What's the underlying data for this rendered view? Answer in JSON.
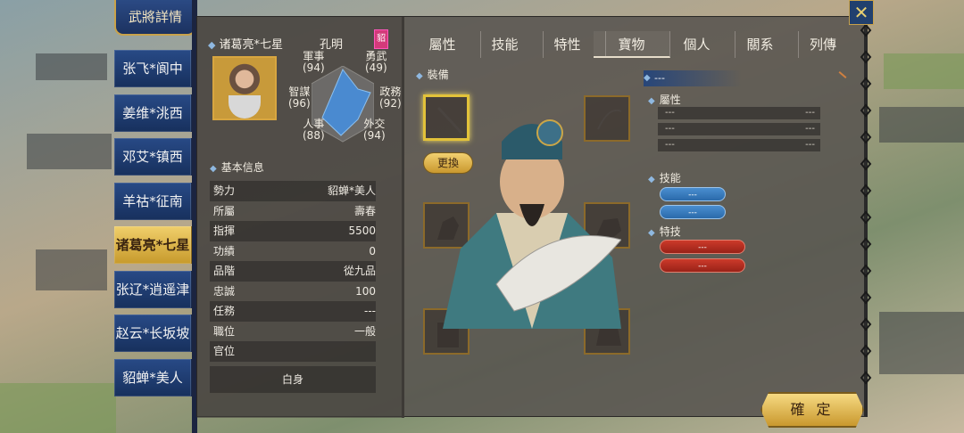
{
  "general_list": {
    "title": "武將詳情",
    "items": [
      {
        "label": "张飞*阆中"
      },
      {
        "label": "姜维*洮西"
      },
      {
        "label": "邓艾*镇西"
      },
      {
        "label": "羊祜*征南"
      },
      {
        "label": "诸葛亮*七星"
      },
      {
        "label": "张辽*逍遥津"
      },
      {
        "label": "赵云*长坂坡"
      },
      {
        "label": "貂蝉*美人"
      }
    ],
    "active_index": 4
  },
  "profile": {
    "name": "诸葛亮*七星",
    "courtesy_name": "孔明",
    "seal": "貂",
    "stats": {
      "military": {
        "label": "軍事",
        "value": "(94)"
      },
      "valor": {
        "label": "勇武",
        "value": "(49)"
      },
      "strategy": {
        "label": "智謀",
        "value": "(96)"
      },
      "politics": {
        "label": "政務",
        "value": "(92)"
      },
      "personnel": {
        "label": "人事",
        "value": "(88)"
      },
      "diplomacy": {
        "label": "外交",
        "value": "(94)"
      }
    },
    "basic_info_title": "基本信息",
    "info": [
      {
        "label": "勢力",
        "value": "貂蝉*美人"
      },
      {
        "label": "所屬",
        "value": "壽春"
      },
      {
        "label": "指揮",
        "value": "5500"
      },
      {
        "label": "功績",
        "value": "0"
      },
      {
        "label": "品階",
        "value": "從九品"
      },
      {
        "label": "忠誠",
        "value": "100"
      },
      {
        "label": "任務",
        "value": "---"
      },
      {
        "label": "職位",
        "value": "一般"
      },
      {
        "label": "官位",
        "value": ""
      }
    ],
    "official_title": "白身"
  },
  "tabs": [
    {
      "label": "屬性"
    },
    {
      "label": "技能"
    },
    {
      "label": "特性"
    },
    {
      "label": "寶物"
    },
    {
      "label": "個人"
    },
    {
      "label": "關系"
    },
    {
      "label": "列傳"
    }
  ],
  "active_tab": 3,
  "equipment": {
    "title": "裝備",
    "change_button": "更換"
  },
  "detail": {
    "name": "---",
    "attributes_title": "屬性",
    "attributes": [
      {
        "l": "---",
        "r": "---"
      },
      {
        "l": "---",
        "r": "---"
      },
      {
        "l": "---",
        "r": "---"
      }
    ],
    "skills_title": "技能",
    "skills": [
      "---",
      "---"
    ],
    "special_title": "特技",
    "specials": [
      "---",
      "---"
    ]
  },
  "confirm_button": "確 定",
  "close_icon": "✕",
  "colors": {
    "accent_gold": "#c9982e",
    "navy": "#1c3260",
    "skill_blue": "#2a6aaa",
    "special_red": "#992218"
  }
}
